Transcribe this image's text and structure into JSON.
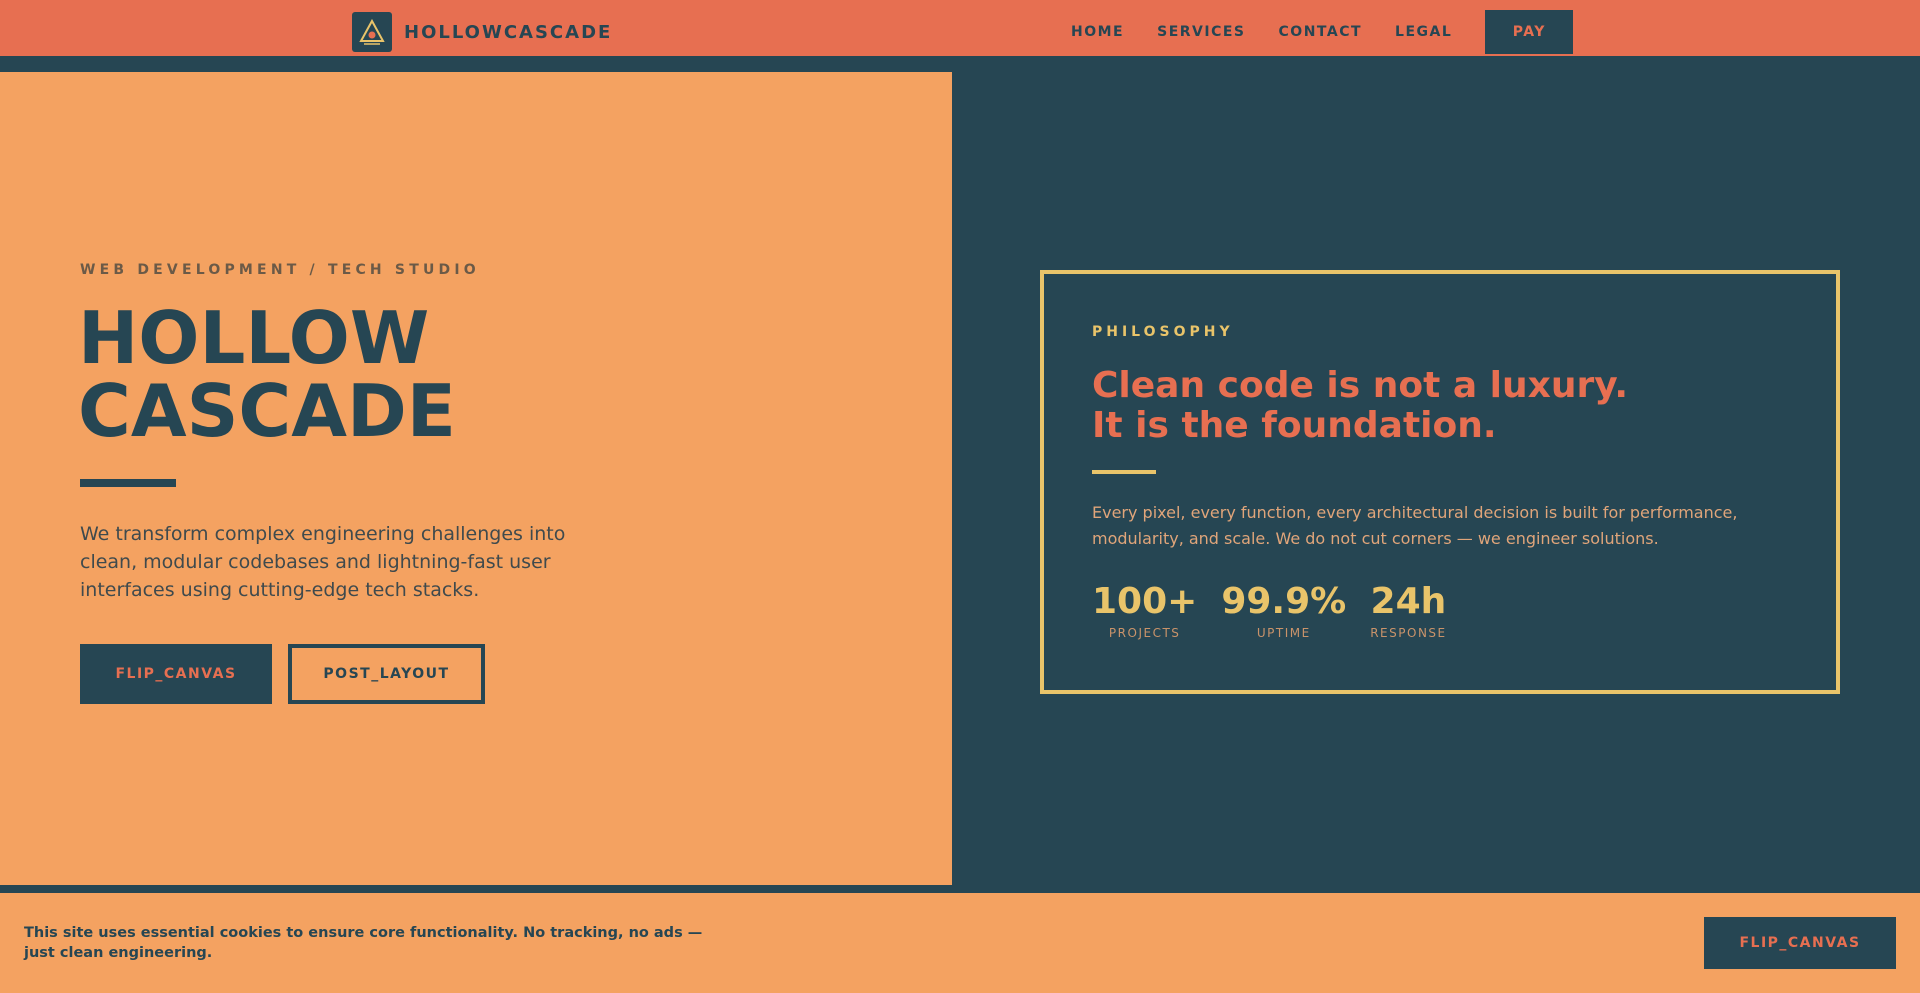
{
  "header": {
    "brand_name": "HOLLOWCASCADE",
    "logo_icon": "triangle-eye-logo-icon",
    "nav": [
      {
        "label": "HOME"
      },
      {
        "label": "SERVICES"
      },
      {
        "label": "CONTACT"
      },
      {
        "label": "LEGAL"
      }
    ],
    "pay_label": "PAY"
  },
  "hero": {
    "eyebrow": "WEB DEVELOPMENT / TECH STUDIO",
    "title_line1": "HOLLOW",
    "title_line2": "CASCADE",
    "description": "We transform complex engineering challenges into clean, modular codebases and lightning-fast user interfaces using cutting-edge tech stacks.",
    "primary_button": "FLIP_CANVAS",
    "secondary_button": "POST_LAYOUT"
  },
  "philosophy": {
    "eyebrow": "PHILOSOPHY",
    "heading_line1": "Clean code is not a luxury.",
    "heading_line2": "It is the foundation.",
    "text": "Every pixel, every function, every architectural decision is built for performance, modularity, and scale. We do not cut corners — we engineer solutions.",
    "stats": [
      {
        "value": "100+",
        "label": "PROJECTS"
      },
      {
        "value": "99.9%",
        "label": "UPTIME"
      },
      {
        "value": "24h",
        "label": "RESPONSE"
      }
    ]
  },
  "cookie": {
    "text": "This site uses essential cookies to ensure core functionality. No tracking, no ads — just clean engineering.",
    "button": "FLIP_CANVAS"
  },
  "colors": {
    "coral": "#e76f51",
    "sand": "#f4a261",
    "navy": "#264653",
    "gold": "#e9c46a"
  }
}
